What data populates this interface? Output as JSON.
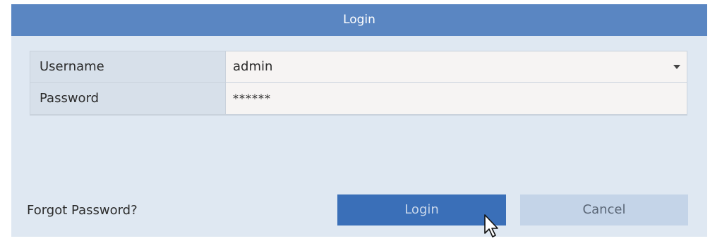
{
  "dialog": {
    "title": "Login"
  },
  "form": {
    "username_label": "Username",
    "username_value": "admin",
    "password_label": "Password",
    "password_value": "******"
  },
  "footer": {
    "forgot_password": "Forgot Password?",
    "login_button": "Login",
    "cancel_button": "Cancel"
  },
  "icons": {
    "dropdown": "chevron-down-icon",
    "cursor": "mouse-pointer-icon"
  },
  "colors": {
    "titlebar": "#5a86c2",
    "background": "#dfe8f2",
    "login_button": "#3a6fb8",
    "cancel_button": "#c4d4e8"
  }
}
